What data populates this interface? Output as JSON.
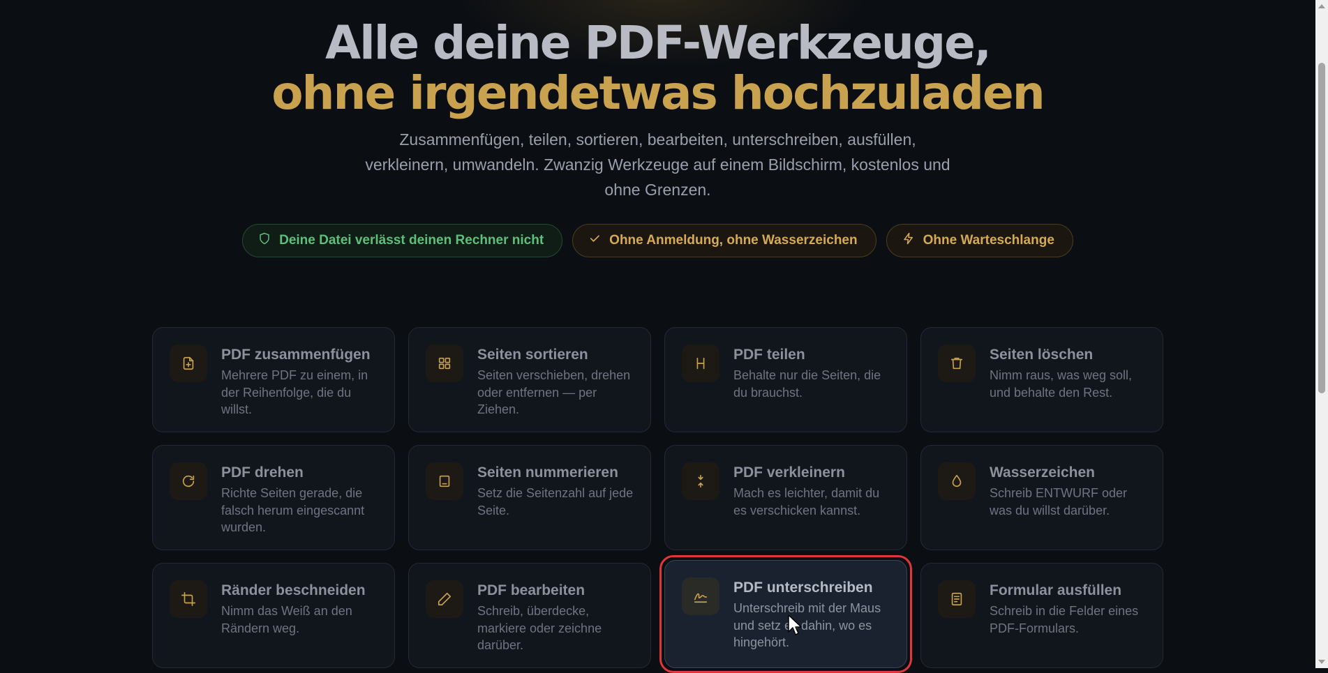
{
  "hero": {
    "title_line1": "Alle deine PDF-Werkzeuge,",
    "title_line2": "ohne irgendetwas hochzuladen",
    "subtitle": "Zusammenfügen, teilen, sortieren, bearbeiten, unterschreiben, ausfüllen, verkleinern, umwandeln. Zwanzig Werkzeuge auf einem Bildschirm, kostenlos und ohne Grenzen."
  },
  "badges": [
    {
      "label": "Deine Datei verlässt deinen Rechner nicht",
      "icon": "shield-icon",
      "color": "#5fbf7a"
    },
    {
      "label": "Ohne Anmeldung, ohne Wasserzeichen",
      "icon": "check-icon",
      "color": "#d4aa55"
    },
    {
      "label": "Ohne Warteschlange",
      "icon": "lightning-icon",
      "color": "#d4aa55"
    }
  ],
  "tools": [
    {
      "title": "PDF zusammenfügen",
      "desc": "Mehrere PDF zu einem, in der Reihenfolge, die du willst.",
      "icon": "file-plus-icon"
    },
    {
      "title": "Seiten sortieren",
      "desc": "Seiten verschieben, drehen oder entfernen — per Ziehen.",
      "icon": "grid-icon"
    },
    {
      "title": "PDF teilen",
      "desc": "Behalte nur die Seiten, die du brauchst.",
      "icon": "split-icon"
    },
    {
      "title": "Seiten löschen",
      "desc": "Nimm raus, was weg soll, und behalte den Rest.",
      "icon": "trash-icon"
    },
    {
      "title": "PDF drehen",
      "desc": "Richte Seiten gerade, die falsch herum eingescannt wurden.",
      "icon": "rotate-icon"
    },
    {
      "title": "Seiten nummerieren",
      "desc": "Setz die Seitenzahl auf jede Seite.",
      "icon": "page-number-icon"
    },
    {
      "title": "PDF verkleinern",
      "desc": "Mach es leichter, damit du es verschicken kannst.",
      "icon": "compress-icon"
    },
    {
      "title": "Wasserzeichen",
      "desc": "Schreib ENTWURF oder was du willst darüber.",
      "icon": "droplet-icon"
    },
    {
      "title": "Ränder beschneiden",
      "desc": "Nimm das Weiß an den Rändern weg.",
      "icon": "crop-icon"
    },
    {
      "title": "PDF bearbeiten",
      "desc": "Schreib, überdecke, markiere oder zeichne darüber.",
      "icon": "pencil-icon"
    },
    {
      "title": "PDF unterschreiben",
      "desc": "Unterschreib mit der Maus und setz es dahin, wo es hingehört.",
      "icon": "signature-icon"
    },
    {
      "title": "Formular ausfüllen",
      "desc": "Schreib in die Felder eines PDF-Formulars.",
      "icon": "form-icon"
    }
  ],
  "colors": {
    "background": "#0b0e13",
    "accent_gold": "#c9a24f",
    "accent_green": "#5fbf7a",
    "highlight_outline": "#e0383a"
  }
}
